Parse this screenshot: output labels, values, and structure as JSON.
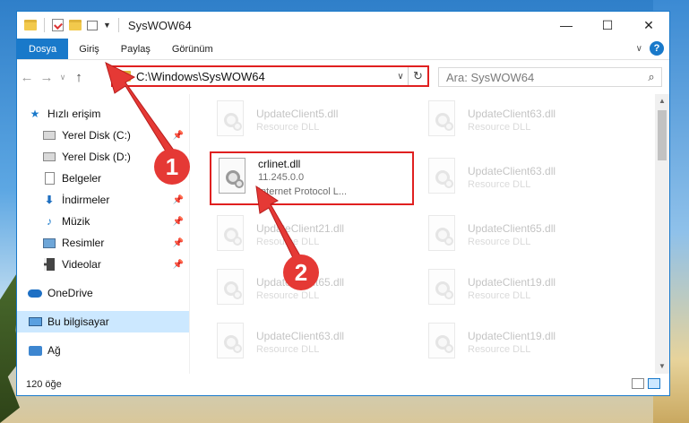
{
  "window": {
    "title": "SysWOW64",
    "controls": {
      "minimize": "—",
      "maximize": "☐",
      "close": "✕"
    }
  },
  "ribbon": {
    "tabs": [
      "Dosya",
      "Giriş",
      "Paylaş",
      "Görünüm"
    ]
  },
  "address": {
    "path": "C:\\Windows\\SysWOW64",
    "search_placeholder": "Ara: SysWOW64"
  },
  "nav": {
    "items": [
      {
        "label": "Hızlı erişim",
        "icon": "star-icon"
      },
      {
        "label": "Yerel Disk (C:)",
        "icon": "drive-icon",
        "pinned": true
      },
      {
        "label": "Yerel Disk (D:)",
        "icon": "drive-icon",
        "pinned": true
      },
      {
        "label": "Belgeler",
        "icon": "document-icon",
        "pinned": true
      },
      {
        "label": "İndirmeler",
        "icon": "download-icon",
        "pinned": true
      },
      {
        "label": "Müzik",
        "icon": "music-icon",
        "pinned": true
      },
      {
        "label": "Resimler",
        "icon": "pictures-icon",
        "pinned": true
      },
      {
        "label": "Videolar",
        "icon": "videos-icon",
        "pinned": true
      },
      {
        "label": "OneDrive",
        "icon": "onedrive-icon"
      },
      {
        "label": "Bu bilgisayar",
        "icon": "computer-icon",
        "selected": true
      },
      {
        "label": "Ağ",
        "icon": "network-icon"
      }
    ]
  },
  "files": {
    "left": [
      {
        "name": "UpdateClient5.dll",
        "line2": "Resource DLL",
        "line3": ""
      },
      {
        "name": "crlinet.dll",
        "line2": "11.245.0.0",
        "line3": "Internet Protocol L..."
      },
      {
        "name": "UpdateClient21.dll",
        "line2": "Resource DLL",
        "line3": ""
      },
      {
        "name": "UpdateClient65.dll",
        "line2": "Resource DLL",
        "line3": ""
      },
      {
        "name": "UpdateClient63.dll",
        "line2": "Resource DLL",
        "line3": ""
      }
    ],
    "right": [
      {
        "name": "UpdateClient63.dll",
        "line2": "Resource DLL"
      },
      {
        "name": "UpdateClient63.dll",
        "line2": "Resource DLL"
      },
      {
        "name": "UpdateClient65.dll",
        "line2": "Resource DLL"
      },
      {
        "name": "UpdateClient19.dll",
        "line2": "Resource DLL"
      },
      {
        "name": "UpdateClient19.dll",
        "line2": "Resource DLL"
      }
    ]
  },
  "status": {
    "count": "120 öğe"
  },
  "annotations": {
    "step1": "1",
    "step2": "2",
    "accent": "#e53935"
  }
}
